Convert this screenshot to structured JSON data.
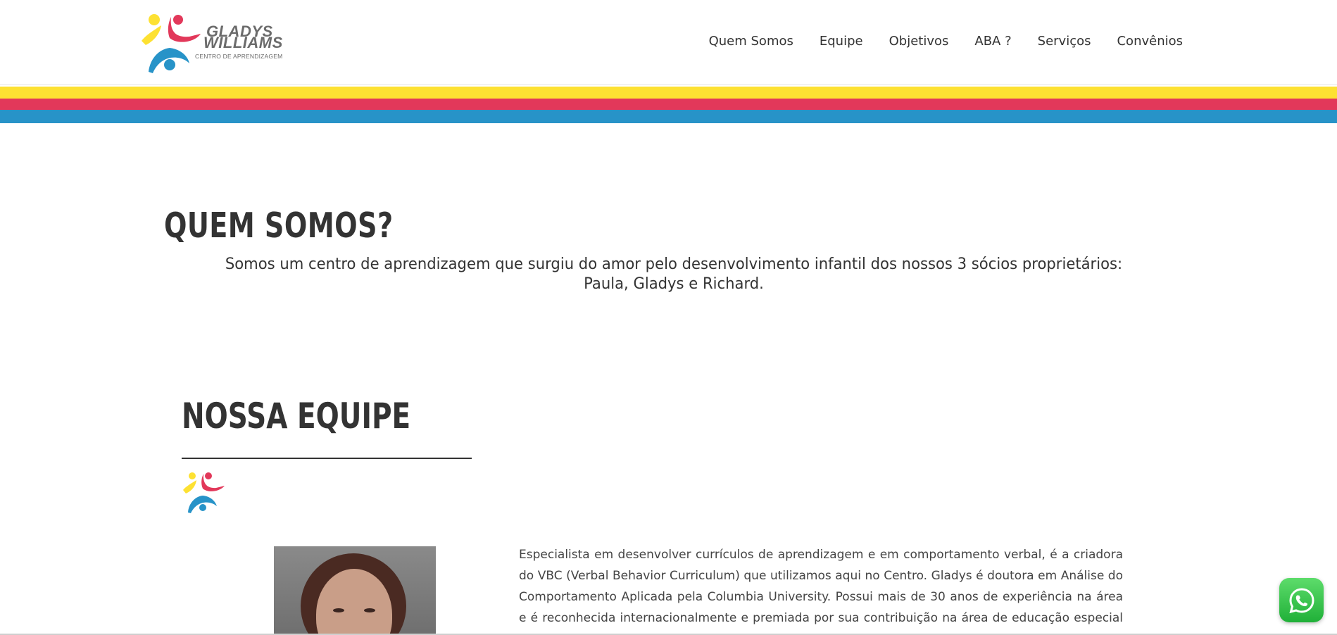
{
  "logo": {
    "line1": "GLADYS",
    "line2": "WILLIAMS",
    "subtitle": "CENTRO DE APRENDIZAGEM"
  },
  "nav": {
    "items": [
      {
        "label": "Quem Somos"
      },
      {
        "label": "Equipe"
      },
      {
        "label": "Objetivos"
      },
      {
        "label": "ABA ?"
      },
      {
        "label": "Serviços"
      },
      {
        "label": "Convênios"
      }
    ]
  },
  "colors": {
    "yellow": "#fde132",
    "pink": "#e2385a",
    "blue": "#2793c8",
    "whatsapp_green": "#25d366"
  },
  "quem_somos": {
    "heading": "QUEM SOMOS?",
    "text": "Somos um centro de aprendizagem que surgiu do amor pelo desenvolvimento infantil dos nossos 3 sócios proprietários: Paula, Gladys e Richard."
  },
  "equipe": {
    "heading": "NOSSA EQUIPE",
    "bio": "Especialista em desenvolver currículos de aprendizagem e em comportamento verbal, é a criadora do VBC (Verbal Behavior Curriculum) que utilizamos aqui no Centro. Gladys é doutora em Análise do Comportamento Aplicada pela Columbia University. Possui mais de 30 anos de experiência na área e é reconhecida  internacionalmente e premiada por sua contribuição na área de educação especial e"
  },
  "icons": {
    "logo": "people-logo-icon",
    "small_logo": "people-logo-icon",
    "whatsapp": "whatsapp-icon"
  }
}
